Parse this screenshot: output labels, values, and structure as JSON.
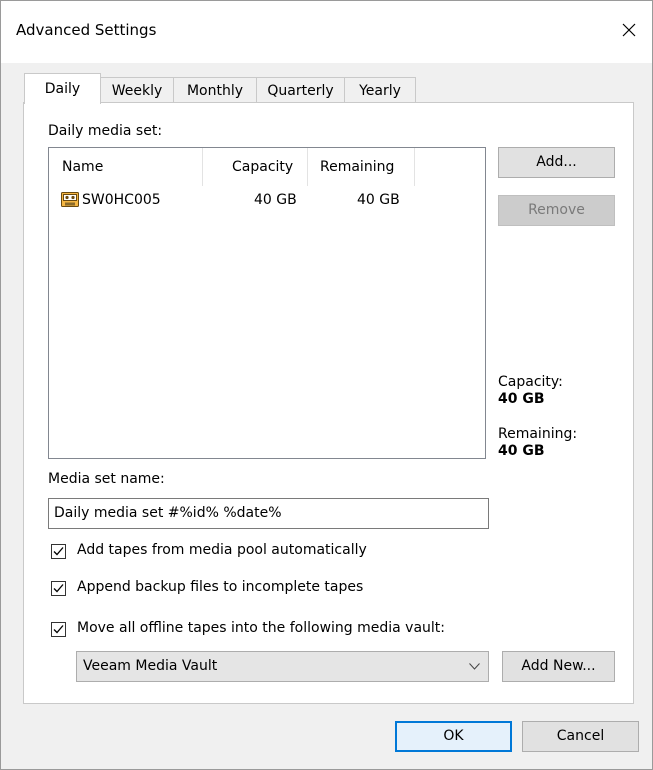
{
  "window": {
    "title": "Advanced Settings"
  },
  "tabs": [
    {
      "label": "Daily"
    },
    {
      "label": "Weekly"
    },
    {
      "label": "Monthly"
    },
    {
      "label": "Quarterly"
    },
    {
      "label": "Yearly"
    }
  ],
  "media_set": {
    "section_label": "Daily media set:",
    "columns": [
      "Name",
      "Capacity",
      "Remaining"
    ],
    "rows": [
      {
        "name": "SW0HC005",
        "capacity": "40 GB",
        "remaining": "40 GB",
        "icon": "tape-icon"
      }
    ],
    "add_label": "Add...",
    "remove_label": "Remove"
  },
  "summary": {
    "capacity_label": "Capacity:",
    "capacity_value": "40 GB",
    "remaining_label": "Remaining:",
    "remaining_value": "40 GB"
  },
  "media_set_name": {
    "label": "Media set name:",
    "value": "Daily media set #%id% %date%"
  },
  "options": [
    {
      "label": "Add tapes from media pool automatically",
      "checked": true
    },
    {
      "label": "Append backup files to incomplete tapes",
      "checked": true
    },
    {
      "label": "Move all offline tapes into the following media vault:",
      "checked": true
    }
  ],
  "vault": {
    "selected": "Veeam Media Vault",
    "add_new_label": "Add New..."
  },
  "footer": {
    "ok_label": "OK",
    "cancel_label": "Cancel"
  },
  "colors": {
    "accent": "#0078d7",
    "dialog_bg": "#f0f0f0"
  }
}
